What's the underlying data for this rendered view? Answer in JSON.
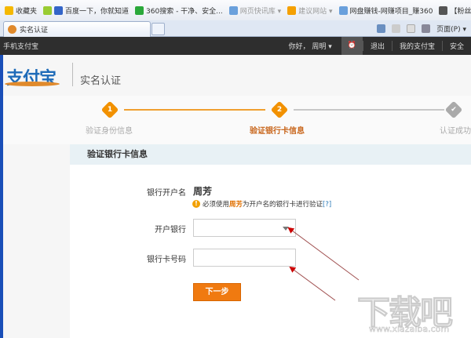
{
  "browser": {
    "favorites": [
      {
        "label": "收藏夹",
        "icon": "star-icon"
      },
      {
        "label": "百度一下，你就知道",
        "icon": "baidu-icon"
      },
      {
        "label": "360搜索 - 干净、安全...",
        "icon": "360-search-icon"
      },
      {
        "label": "网页快讯库 ▾",
        "icon": "ie-icon"
      },
      {
        "label": "建议网站 ▾",
        "icon": "suggest-icon"
      },
      {
        "label": "网盘赚钱-网赚项目_赚360",
        "icon": "ie-icon"
      },
      {
        "label": "【粉丝工",
        "icon": "tool-icon"
      }
    ],
    "tab_title": "实名认证",
    "tools": {
      "page_label": "页面(P) ▾"
    }
  },
  "topnav": {
    "mobile": "手机支付宝",
    "greeting": "你好， 周明 ▾",
    "logout": "退出",
    "my_alipay": "我的支付宝",
    "security": "安全"
  },
  "header": {
    "logo": "支付宝",
    "title": "实名认证"
  },
  "steps": [
    {
      "num": "1",
      "label": "验证身份信息",
      "state": "done"
    },
    {
      "num": "2",
      "label": "验证银行卡信息",
      "state": "active"
    },
    {
      "num": "✔",
      "label": "认证成功",
      "state": "pending"
    }
  ],
  "colors": {
    "accent": "#f29100",
    "button": "#f07a10"
  },
  "form": {
    "section_title": "验证银行卡信息",
    "account_name_label": "银行开户名",
    "account_name": "周芳",
    "notice_prefix": "必须使用",
    "notice_name": "周芳",
    "notice_suffix": "为开户名的银行卡进行验证",
    "notice_help": "[?]",
    "bank_label": "开户银行",
    "bank_value": "",
    "card_label": "银行卡号码",
    "card_value": "",
    "next_button": "下一步"
  },
  "watermark": {
    "text": "下载吧",
    "url": "www.xiazaiba.com"
  }
}
